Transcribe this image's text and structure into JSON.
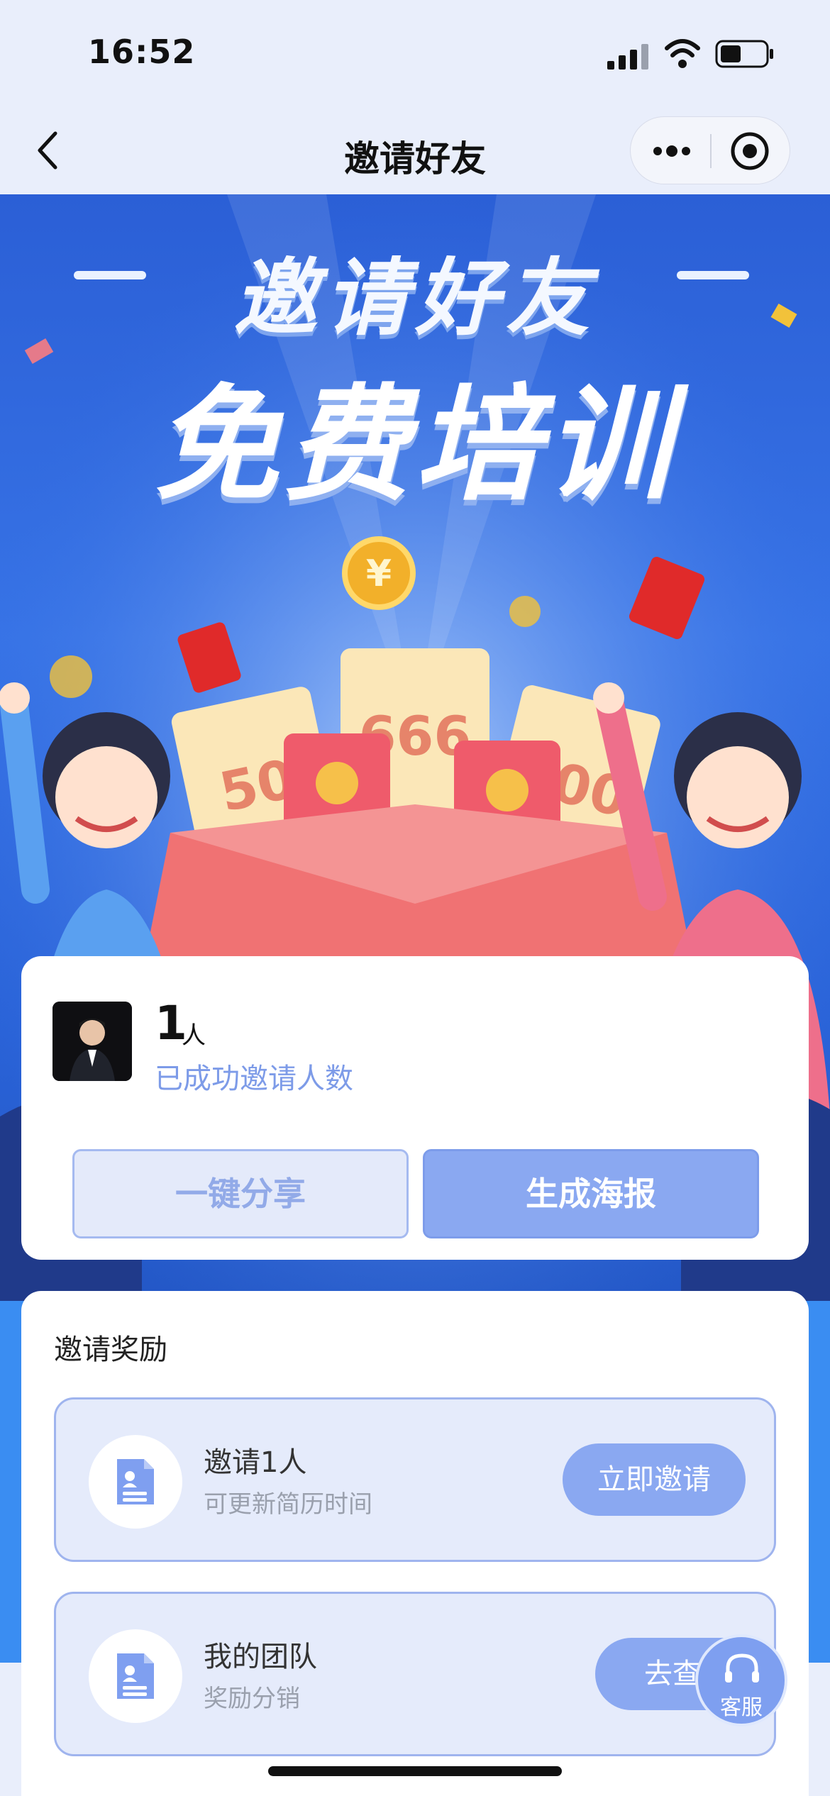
{
  "status_bar": {
    "time": "16:52"
  },
  "nav": {
    "title": "邀请好友"
  },
  "banner": {
    "headline": "邀请好友",
    "subheadline": "免费培训",
    "ticket_values": [
      "50",
      "666",
      "100"
    ]
  },
  "stats": {
    "count": "1",
    "unit": "人",
    "label": "已成功邀请人数",
    "share_label": "一键分享",
    "poster_label": "生成海报"
  },
  "rewards": {
    "title": "邀请奖励",
    "items": [
      {
        "title": "邀请1人",
        "subtitle": "可更新简历时间",
        "action": "立即邀请"
      },
      {
        "title": "我的团队",
        "subtitle": "奖励分销",
        "action": "去查看"
      }
    ]
  },
  "customer_service": {
    "label": "客服"
  },
  "colors": {
    "accent": "#8aa8f1",
    "banner_blue": "#3773e6",
    "label_blue": "#7d9be8"
  }
}
